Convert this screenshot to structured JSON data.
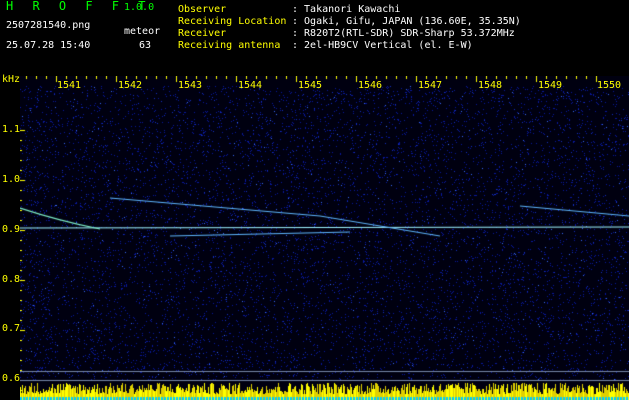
{
  "header": {
    "app_title": "H R O F F T",
    "app_version": "1.0.0",
    "file_name": "2507281540.png",
    "meteor_label": "meteor",
    "meteor_count": "63",
    "datetime": "25.07.28 15:40"
  },
  "info": {
    "observer_label": "Observer",
    "observer_value": ": Takanori Kawachi",
    "location_label": "Receiving Location",
    "location_value": ": Ogaki, Gifu, JAPAN (136.60E, 35.35N)",
    "receiver_label": "Receiver",
    "receiver_value": ": R820T2(RTL-SDR) SDR-Sharp 53.372MHz",
    "antenna_label": "Receiving antenna",
    "antenna_value": ": 2el-HB9CV Vertical (el. E-W)"
  },
  "axes": {
    "y_unit": "kHz",
    "y_ticks": [
      "1.1",
      "1.0",
      "0.9",
      "0.8",
      "0.7",
      "0.6"
    ],
    "x_ticks": [
      "1541",
      "1542",
      "1543",
      "1544",
      "1545",
      "1546",
      "1547",
      "1548",
      "1549",
      "1550"
    ]
  },
  "colors": {
    "background": "#000000",
    "noise": "#0a1eaa",
    "text_white": "#ffffff",
    "text_yellow": "#ffff00",
    "text_green": "#00ff00",
    "signal": "#a8f0ff"
  }
}
